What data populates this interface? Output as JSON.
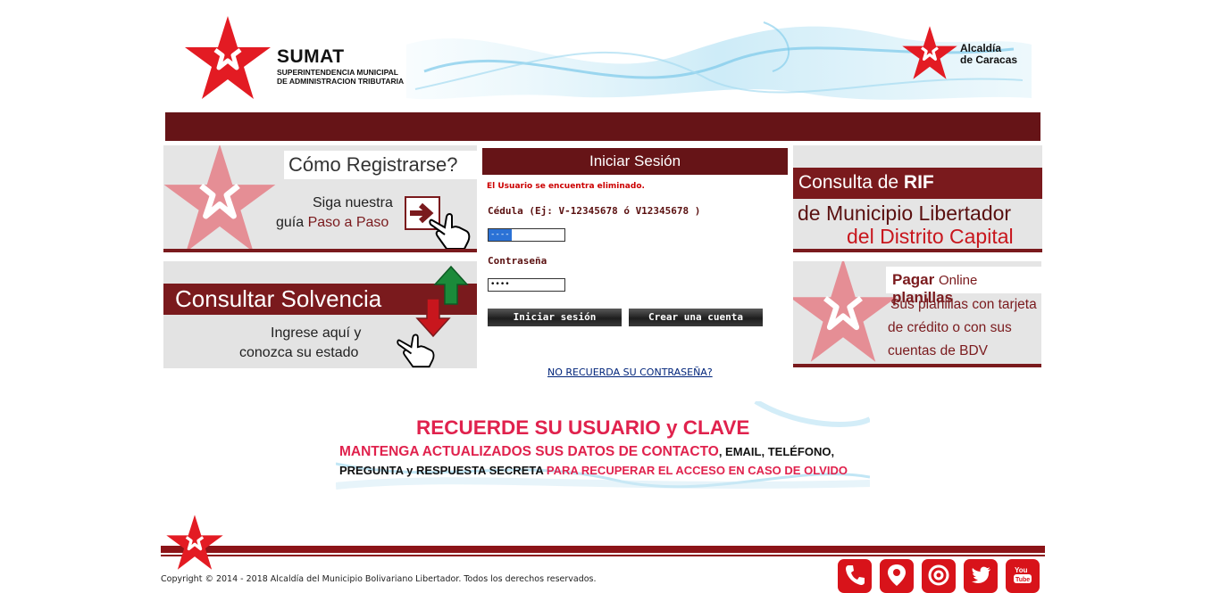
{
  "header": {
    "logo_title": "SUMAT",
    "logo_subtitle_1": "SUPERINTENDENCIA MUNICIPAL",
    "logo_subtitle_2": "DE ADMINISTRACION TRIBUTARIA",
    "alcaldia_1": "Alcaldía",
    "alcaldia_2": "de Caracas"
  },
  "banners": {
    "registrarse": {
      "title": "Cómo Registrarse?",
      "line1": "Siga nuestra",
      "line2_a": "guía ",
      "line2_b": "Paso a Paso"
    },
    "solvencia": {
      "title": "Consultar Solvencia",
      "line1": "Ingrese aquí y",
      "line2": "conozca su estado"
    },
    "rif": {
      "title_a": "Consulta de ",
      "title_b": "RIF",
      "line1": "de Municipio Libertador",
      "line2": "del Distrito Capital"
    },
    "pagar": {
      "title_a": "Pagar ",
      "title_b": "Online ",
      "title_c": "planillas",
      "line1": "Sus planillas con tarjeta",
      "line2": "de crédito o con sus",
      "line3": "cuentas de BDV"
    }
  },
  "login": {
    "header": "Iniciar Sesión",
    "error": "El Usuario se encuentra eliminado.",
    "cedula_label": "Cédula (Ej: V-12345678 ó V12345678 )",
    "cedula_value": "----",
    "password_label": "Contraseña",
    "password_value": "••••",
    "login_button": "Iniciar sesión",
    "create_button": "Crear una cuenta",
    "forgot_link": "NO RECUERDA SU CONTRASEÑA?"
  },
  "notice": {
    "line1": "RECUERDE SU USUARIO y CLAVE",
    "line2_a": "MANTENGA ACTUALIZADOS SUS DATOS DE CONTACTO",
    "line2_b": ", EMAIL, TELÉFONO,",
    "line3_a": "PREGUNTA y RESPUESTA SECRETA ",
    "line3_b": "PARA RECUPERAR EL ACCESO EN CASO DE OLVIDO"
  },
  "footer": {
    "copyright": "Copyright © 2014 - 2018 Alcaldía del Municipio Bolivariano Libertador. Todos los derechos reservados.",
    "social_youtube_text": "You Tube"
  },
  "colors": {
    "brand_dark": "#661417",
    "brand_red": "#e31b23",
    "notice_red": "#e0224d"
  },
  "icons": [
    "star-logo-icon",
    "hand-pointer-icon",
    "arrow-right-icon",
    "arrow-up-icon",
    "arrow-down-icon",
    "phone-icon",
    "location-pin-icon",
    "at-sign-icon",
    "twitter-icon",
    "youtube-icon"
  ]
}
